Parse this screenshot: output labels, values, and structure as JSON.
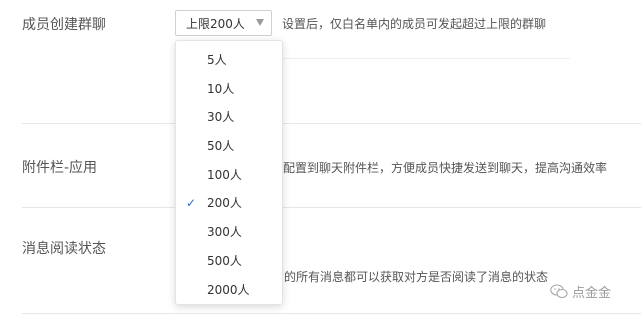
{
  "rows": {
    "group_chat": {
      "label": "成员创建群聊",
      "select_value": "上限200人",
      "description": "设置后，仅白名单内的成员可发起超过上限的群聊"
    },
    "attachment": {
      "label": "附件栏-应用",
      "description": "配置到聊天附件栏，方便成员快捷发送到聊天，提高沟通效率"
    },
    "read_status": {
      "label": "消息阅读状态",
      "description": "的所有消息都可以获取对方是否阅读了消息的状态"
    }
  },
  "dropdown": {
    "options": [
      "5人",
      "10人",
      "30人",
      "50人",
      "100人",
      "200人",
      "300人",
      "500人",
      "2000人"
    ],
    "selected": "200人",
    "check_glyph": "✓"
  },
  "watermark": {
    "text": "点金金",
    "icon": "wechat-icon"
  },
  "colors": {
    "accent": "#2b6fd6",
    "divider": "#e6e6e6",
    "text": "#333333",
    "muted": "#9a9a9a"
  }
}
